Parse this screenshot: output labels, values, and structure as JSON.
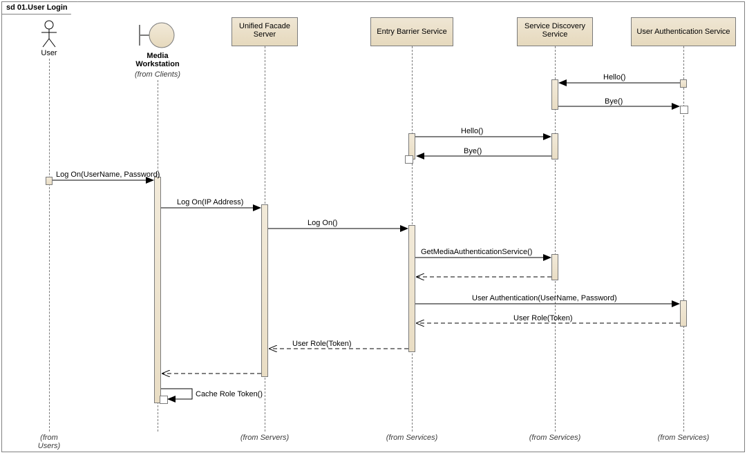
{
  "frame": {
    "title": "sd 01.User Login"
  },
  "participants": {
    "user": {
      "label": "User",
      "from": "(from Users)"
    },
    "media": {
      "label": "Media\nWorkstation",
      "from": "(from Clients)"
    },
    "facade": {
      "label": "Unified Facade\nServer",
      "from": "(from Servers)"
    },
    "entry": {
      "label": "Entry Barrier Service",
      "from": "(from Services)"
    },
    "discovery": {
      "label": "Service Discovery\nService",
      "from": "(from Services)"
    },
    "auth": {
      "label": "User Authentication Service",
      "from": "(from Services)"
    }
  },
  "messages": {
    "m1": "Hello()",
    "m2": "Bye()",
    "m3": "Hello()",
    "m4": "Bye()",
    "m5": "Log On(UserName, Password)",
    "m6": "Log On(IP Address)",
    "m7": "Log On()",
    "m8": "GetMediaAuthenticationService()",
    "m9": "User Authentication(UserName, Password)",
    "m10": "User Role(Token)",
    "m11": "User Role(Token)",
    "m12": "Cache Role Token()"
  },
  "diagram_data": {
    "type": "uml-sequence-diagram",
    "name": "01.User Login",
    "participants": [
      {
        "id": "user",
        "name": "User",
        "kind": "actor",
        "package": "Users"
      },
      {
        "id": "media",
        "name": "Media Workstation",
        "kind": "boundary",
        "package": "Clients"
      },
      {
        "id": "facade",
        "name": "Unified Facade Server",
        "kind": "object",
        "package": "Servers"
      },
      {
        "id": "entry",
        "name": "Entry Barrier Service",
        "kind": "object",
        "package": "Services"
      },
      {
        "id": "discovery",
        "name": "Service Discovery Service",
        "kind": "object",
        "package": "Services"
      },
      {
        "id": "auth",
        "name": "User Authentication Service",
        "kind": "object",
        "package": "Services"
      }
    ],
    "messages": [
      {
        "from": "auth",
        "to": "discovery",
        "label": "Hello()",
        "type": "sync"
      },
      {
        "from": "discovery",
        "to": "auth",
        "label": "Bye()",
        "type": "sync"
      },
      {
        "from": "entry",
        "to": "discovery",
        "label": "Hello()",
        "type": "sync"
      },
      {
        "from": "discovery",
        "to": "entry",
        "label": "Bye()",
        "type": "sync"
      },
      {
        "from": "user",
        "to": "media",
        "label": "Log On(UserName, Password)",
        "type": "sync"
      },
      {
        "from": "media",
        "to": "facade",
        "label": "Log On(IP Address)",
        "type": "sync"
      },
      {
        "from": "facade",
        "to": "entry",
        "label": "Log On()",
        "type": "sync"
      },
      {
        "from": "entry",
        "to": "discovery",
        "label": "GetMediaAuthenticationService()",
        "type": "sync"
      },
      {
        "from": "discovery",
        "to": "entry",
        "label": "",
        "type": "return"
      },
      {
        "from": "entry",
        "to": "auth",
        "label": "User Authentication(UserName, Password)",
        "type": "sync"
      },
      {
        "from": "auth",
        "to": "entry",
        "label": "User Role(Token)",
        "type": "return"
      },
      {
        "from": "entry",
        "to": "facade",
        "label": "User Role(Token)",
        "type": "return"
      },
      {
        "from": "facade",
        "to": "media",
        "label": "",
        "type": "return"
      },
      {
        "from": "media",
        "to": "media",
        "label": "Cache Role Token()",
        "type": "self"
      }
    ]
  }
}
